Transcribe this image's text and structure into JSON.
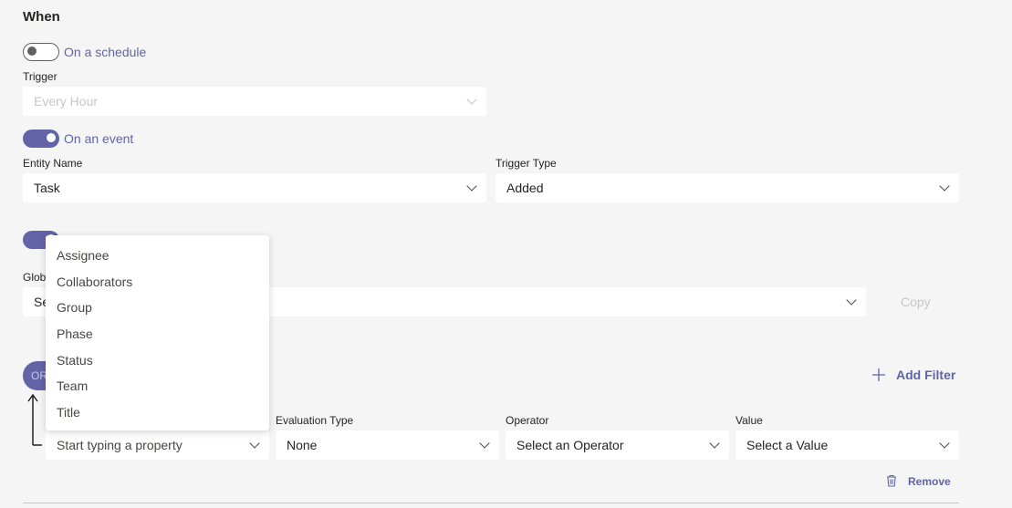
{
  "section_title": "When",
  "schedule": {
    "toggle_label": "On a schedule",
    "trigger_label": "Trigger",
    "trigger_value": "Every Hour"
  },
  "event": {
    "toggle_label": "On an event",
    "entity_label": "Entity Name",
    "entity_value": "Task",
    "trigger_type_label": "Trigger Type",
    "trigger_type_value": "Added"
  },
  "global": {
    "label_partial": "Glob",
    "select_partial": "Se",
    "copy_label": "Copy"
  },
  "filters": {
    "or_label": "OR",
    "add_filter_label": "Add Filter",
    "property_placeholder": "Start typing a property",
    "evaluation_label": "Evaluation Type",
    "evaluation_value": "None",
    "operator_label": "Operator",
    "operator_value": "Select an Operator",
    "value_label": "Value",
    "value_value": "Select a Value",
    "remove_label": "Remove"
  },
  "property_options": [
    "Assignee",
    "Collaborators",
    "Group",
    "Phase",
    "Status",
    "Team",
    "Title"
  ]
}
